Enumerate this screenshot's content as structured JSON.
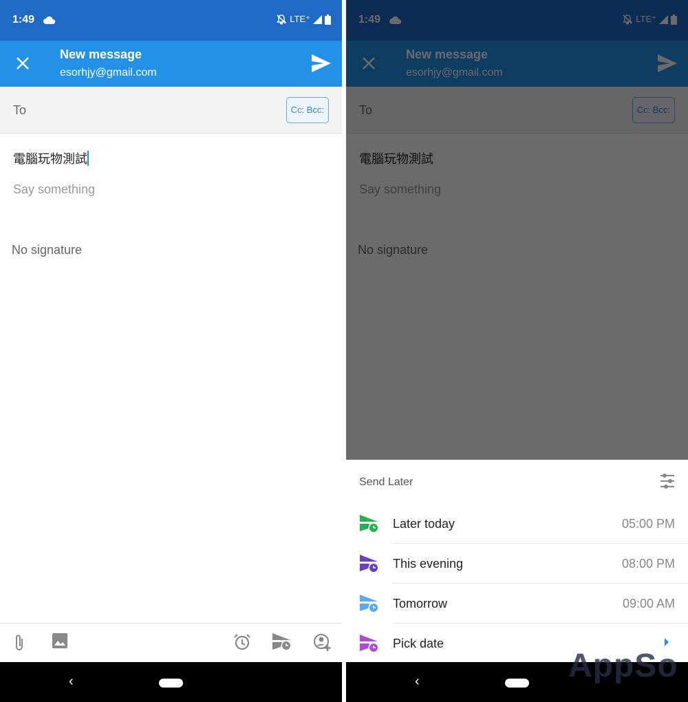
{
  "status": {
    "time": "1:49",
    "network": "LTE⁺"
  },
  "header": {
    "title": "New message",
    "account": "esorhjy@gmail.com"
  },
  "compose": {
    "to_label": "To",
    "cc_bcc_label": "Cc: Bcc:",
    "subject": "電腦玩物測試",
    "body_placeholder": "Say something",
    "signature": "No signature"
  },
  "toolbar": [
    "paperclip-icon",
    "image-icon",
    "alarm-icon",
    "send-later-icon",
    "add-contact-icon"
  ],
  "send_later": {
    "title": "Send Later",
    "options": [
      {
        "label": "Later today",
        "value": "05:00 PM",
        "color": "#22b14c"
      },
      {
        "label": "This evening",
        "value": "08:00 PM",
        "color": "#6a3fc8"
      },
      {
        "label": "Tomorrow",
        "value": "09:00 AM",
        "color": "#5aaaf0"
      },
      {
        "label": "Pick date",
        "value": "",
        "color": "#b04ad8"
      }
    ]
  },
  "watermark": "AppSo"
}
